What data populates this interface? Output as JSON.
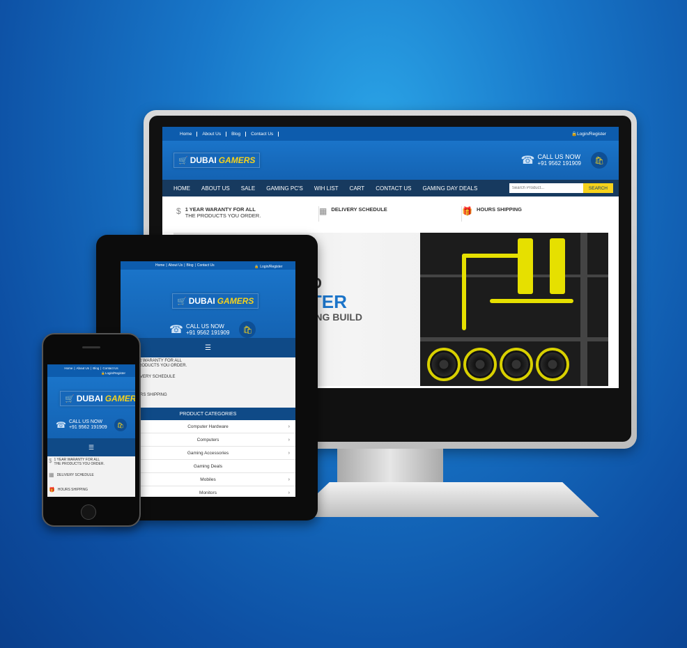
{
  "brand": {
    "word1": "DUBAI",
    "word2": "GAMERS"
  },
  "topbar": {
    "links": [
      "Home",
      "About Us",
      "Blog",
      "Contact Us"
    ],
    "login": "Login/Register"
  },
  "call": {
    "label": "CALL US NOW",
    "number": "+91 9562 191909"
  },
  "nav": [
    "HOME",
    "ABOUT US",
    "SALE",
    "GAMING PC'S",
    "WIH LIST",
    "CART",
    "CONTACT US",
    "GAMING DAY DEALS"
  ],
  "search": {
    "placeholder": "Search Product...",
    "button": "SEARCH"
  },
  "features": {
    "warranty_1": "1 YEAR WARANTY FOR ALL",
    "warranty_2": "THE PRODUCTS YOU ORDER.",
    "delivery": "DELIVERY SCHEDULE",
    "hours": "HOURS SHIPPING"
  },
  "banner": {
    "line1": "OD",
    "line2": "ATER",
    "line3": "OLING BUILD"
  },
  "tablet": {
    "warranty_1": "R WARANTY FOR ALL",
    "warranty_2": "RODUCTS YOU ORDER.",
    "delivery": "VERY SCHEDULE",
    "hours": "RS SHIPPING",
    "categories_title": "PRODUCT CATEGORIES",
    "categories": [
      "Computer Hardware",
      "Computers",
      "Gaming Accessories",
      "Gaming Deals",
      "Mobiles",
      "Monitors"
    ]
  },
  "menu_icon": "hamburger-icon",
  "colors": {
    "primary": "#1463b3",
    "dark_nav": "#173a5f",
    "accent": "#f6d21b"
  }
}
